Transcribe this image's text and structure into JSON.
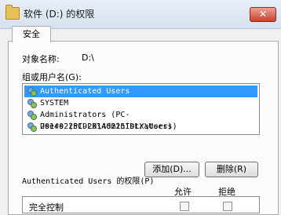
{
  "window": {
    "title": "软件 (D:) 的权限",
    "close_glyph": "✕"
  },
  "tabs": [
    {
      "label": "安全"
    }
  ],
  "object": {
    "label": "对象名称:",
    "value": "D:\\"
  },
  "groups": {
    "label": "组或用户名(G):",
    "items": [
      {
        "label": "Authenticated Users",
        "selected": true
      },
      {
        "label": "SYSTEM",
        "selected": false
      },
      {
        "label": "Administrators (PC-20140225IDLX\\Administrators)",
        "selected": false
      },
      {
        "label": "Users (PC-20140225IDLX\\Users)",
        "selected": false
      }
    ]
  },
  "buttons": {
    "add": "添加(D)...",
    "remove": "删除(R)"
  },
  "permissions": {
    "label": "Authenticated Users 的权限(P)",
    "allow_header": "允许",
    "deny_header": "拒绝",
    "rows": [
      {
        "label": "完全控制"
      }
    ]
  },
  "colors": {
    "selection": "#3399ff",
    "close": "#c9402b"
  }
}
